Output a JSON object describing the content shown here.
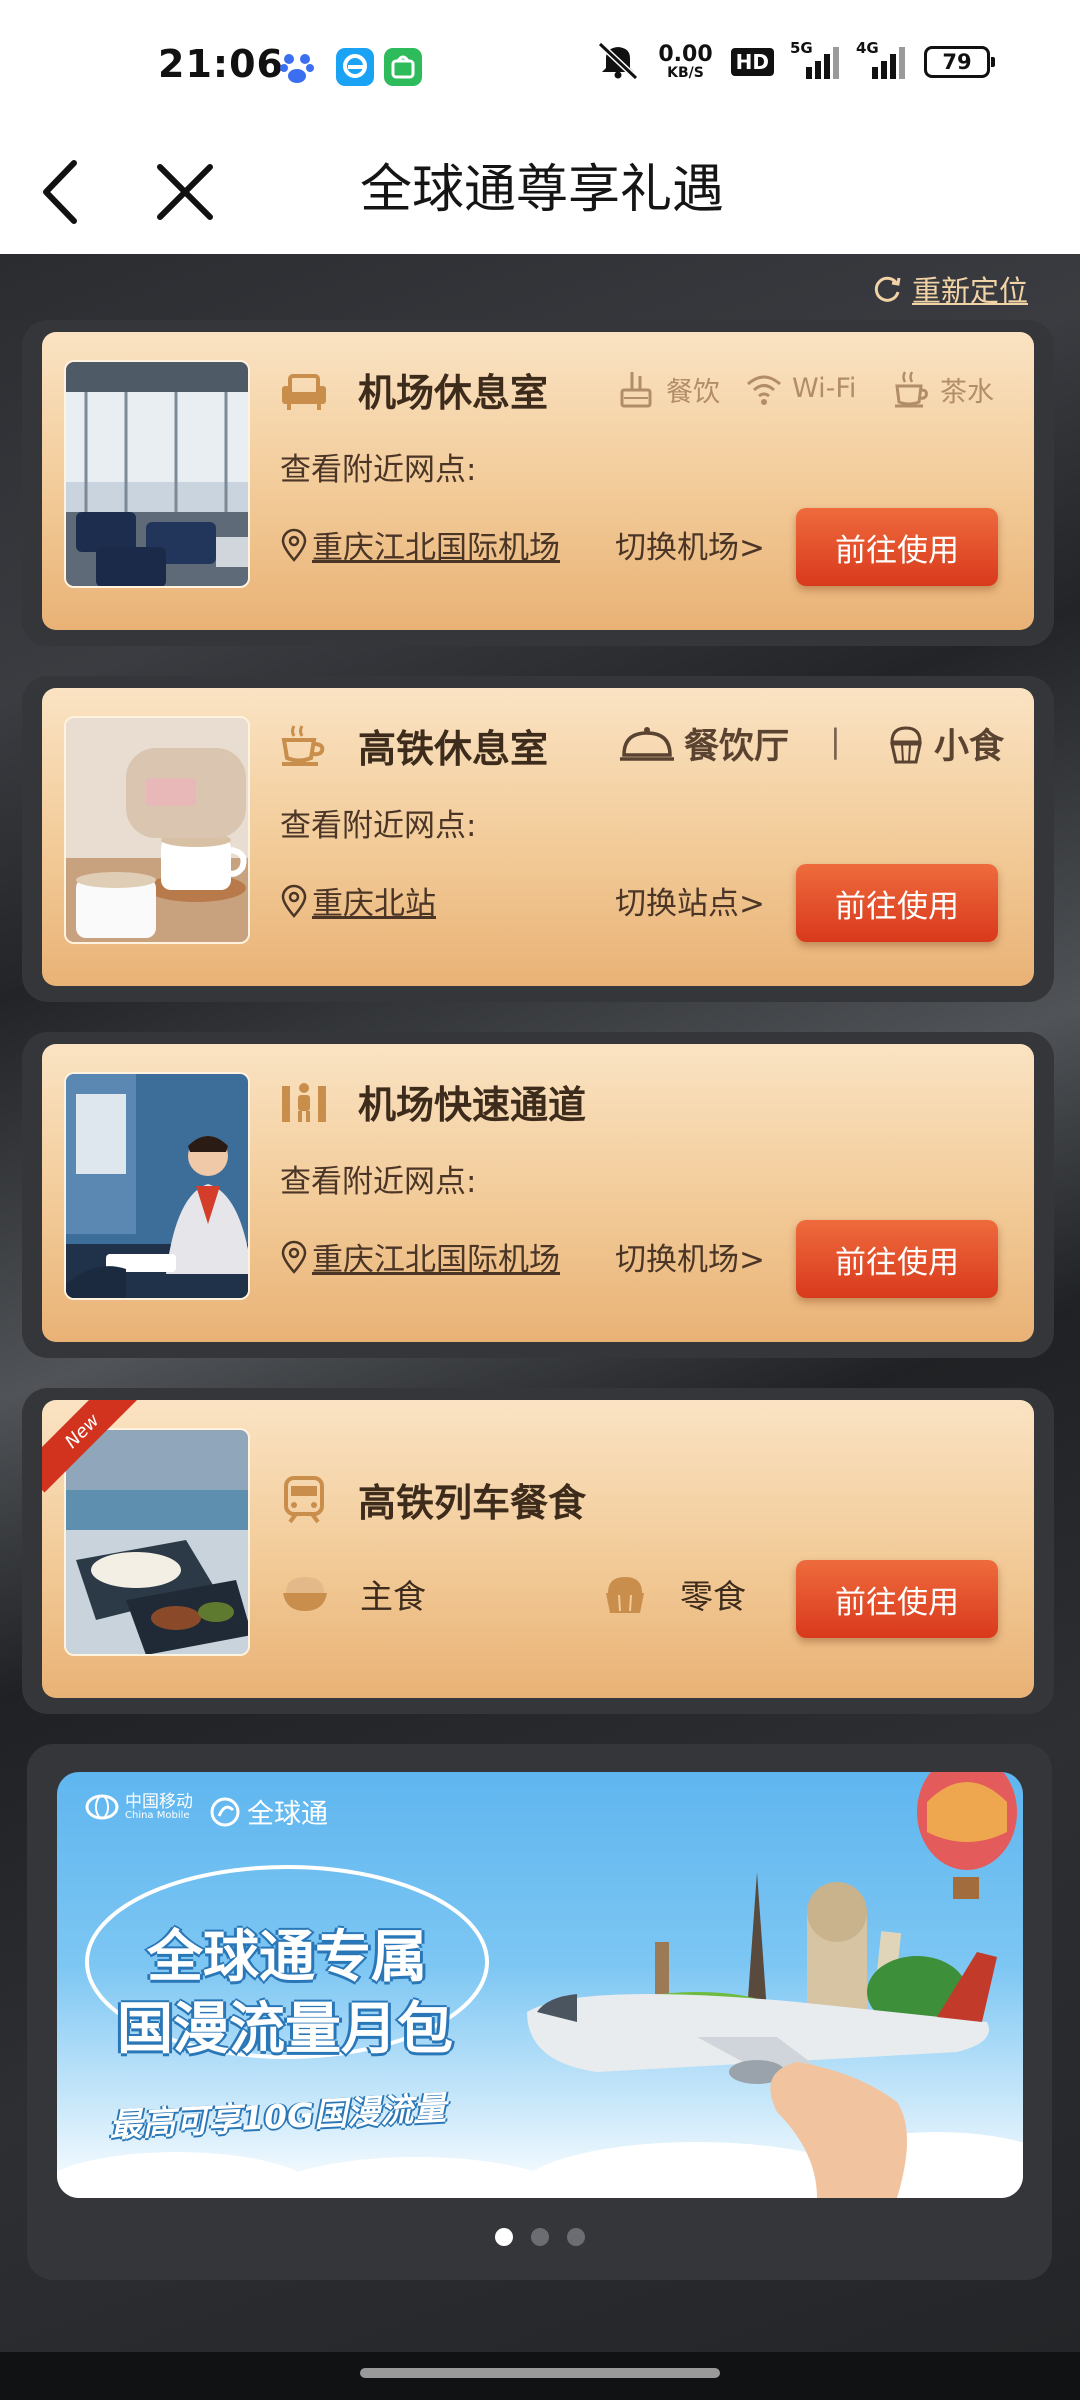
{
  "status_bar": {
    "time": "21:06",
    "net_speed_value": "0.00",
    "net_speed_unit": "KB/S",
    "hd_label": "HD",
    "signal1_label": "5G",
    "signal2_label": "4G",
    "battery": "79",
    "icons": [
      "baidu-app-icon",
      "browser-app-icon",
      "shop-app-icon",
      "mute-icon"
    ]
  },
  "nav": {
    "title": "全球通尊享礼遇"
  },
  "relocate_label": "重新定位",
  "cards": [
    {
      "title": "机场休息室",
      "nearby_label": "查看附近网点:",
      "location": "重庆江北国际机场",
      "switch_label": "切换机场>",
      "button": "前往使用",
      "amenities": [
        "餐饮",
        "Wi-Fi",
        "茶水"
      ]
    },
    {
      "title": "高铁休息室",
      "nearby_label": "查看附近网点:",
      "location": "重庆北站",
      "switch_label": "切换站点>",
      "button": "前往使用",
      "amenities": [
        "餐饮厅",
        "|",
        "小食"
      ]
    },
    {
      "title": "机场快速通道",
      "nearby_label": "查看附近网点:",
      "location": "重庆江北国际机场",
      "switch_label": "切换机场>",
      "button": "前往使用"
    },
    {
      "title": "高铁列车餐食",
      "badge": "New",
      "food": [
        "主食",
        "零食"
      ],
      "button": "前往使用"
    }
  ],
  "banner": {
    "brand1": "中国移动",
    "brand1_sub": "China Mobile",
    "brand2": "全球通",
    "headline1": "全球通专属",
    "headline2": "国漫流量月包",
    "sub": "最高可享10G国漫流量",
    "dots": 3,
    "active_dot": 1
  }
}
